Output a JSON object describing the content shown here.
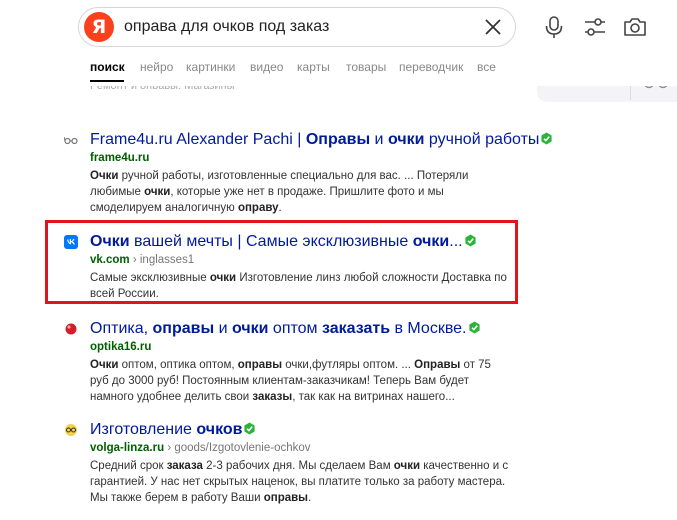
{
  "search": {
    "query": "оправа для очков под заказ"
  },
  "tabs": [
    {
      "label": "поиск",
      "active": true
    },
    {
      "label": "нейро",
      "active": false
    },
    {
      "label": "картинки",
      "active": false
    },
    {
      "label": "видео",
      "active": false
    },
    {
      "label": "карты",
      "active": false
    },
    {
      "label": "товары",
      "active": false
    },
    {
      "label": "переводчик",
      "active": false
    },
    {
      "label": "все",
      "active": false
    }
  ],
  "ghost_text": "Ремонт и оправы. Магазины",
  "results": [
    {
      "favicon": "glasses-icon",
      "title_html": "Frame4u.ru Alexander Pachi | <b>Оправы</b> и <b>очки</b> ручной работы",
      "url_html": "<b>frame4u.ru</b>",
      "snippet_html": "<b>Очки</b> ручной работы, изготовленные специально для вас. ... Потеряли любимые <b>очки</b>, которые уже нет в продаже. Пришлите фото и мы смоделируем аналогичную <b>оправу</b>."
    },
    {
      "favicon": "vk-icon",
      "title_html": "<b>Очки</b> вашей мечты | Самые эксклюзивные <b>очки</b>...",
      "url_html": "<b>vk.com</b> <span class=\"path\">› inglasses1</span>",
      "snippet_html": "Самые эксклюзивные <b>очки</b> Изготовление линз любой сложности Доставка по всей России."
    },
    {
      "favicon": "optika-icon",
      "title_html": "Оптика, <b>оправы</b> и <b>очки</b> оптом <b>заказать</b> в Москве.",
      "url_html": "<b>optika16.ru</b>",
      "snippet_html": "<b>Очки</b> оптом, оптика оптом, <b>оправы</b> очки,футляры оптом. ... <b>Оправы</b> от 75 руб до 3000 руб! Постоянным клиентам-заказчикам! Теперь Вам будет намного удобнее делить свои <b>заказы</b>, так как на витринах нашего..."
    },
    {
      "favicon": "volga-icon",
      "title_html": "Изготовление <b>очков</b>",
      "url_html": "<b>volga-linza.ru</b> <span class=\"path\">› goods/Izgotovlenie-ochkov</span>",
      "snippet_html": "Средний срок <b>заказа</b> 2-3 рабочих дня. Мы сделаем Вам <b>очки</b> качественно и с гарантией. У нас нет скрытых наценок, вы платите только за работу мастера. Мы также берем в работу Ваши <b>оправы</b>."
    }
  ]
}
